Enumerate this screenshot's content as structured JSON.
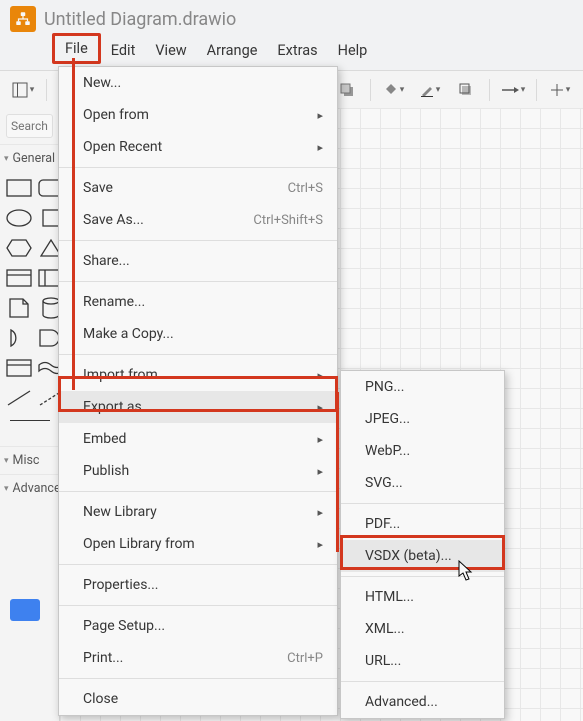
{
  "title": "Untitled Diagram.drawio",
  "menubar": {
    "file": "File",
    "edit": "Edit",
    "view": "View",
    "arrange": "Arrange",
    "extras": "Extras",
    "help": "Help"
  },
  "search": {
    "placeholder": "Search Shapes"
  },
  "panels": {
    "general": "General",
    "misc": "Misc",
    "advanced": "Advanced"
  },
  "fileMenu": {
    "new": "New...",
    "openFrom": "Open from",
    "openRecent": "Open Recent",
    "save": "Save",
    "saveShortcut": "Ctrl+S",
    "saveAs": "Save As...",
    "saveAsShortcut": "Ctrl+Shift+S",
    "share": "Share...",
    "rename": "Rename...",
    "makeCopy": "Make a Copy...",
    "importFrom": "Import from",
    "exportAs": "Export as",
    "embed": "Embed",
    "publish": "Publish",
    "newLibrary": "New Library",
    "openLibraryFrom": "Open Library from",
    "properties": "Properties...",
    "pageSetup": "Page Setup...",
    "print": "Print...",
    "printShortcut": "Ctrl+P",
    "close": "Close"
  },
  "exportMenu": {
    "png": "PNG...",
    "jpeg": "JPEG...",
    "webp": "WebP...",
    "svg": "SVG...",
    "pdf": "PDF...",
    "vsdx": "VSDX (beta)...",
    "html": "HTML...",
    "xml": "XML...",
    "url": "URL...",
    "advanced": "Advanced..."
  }
}
